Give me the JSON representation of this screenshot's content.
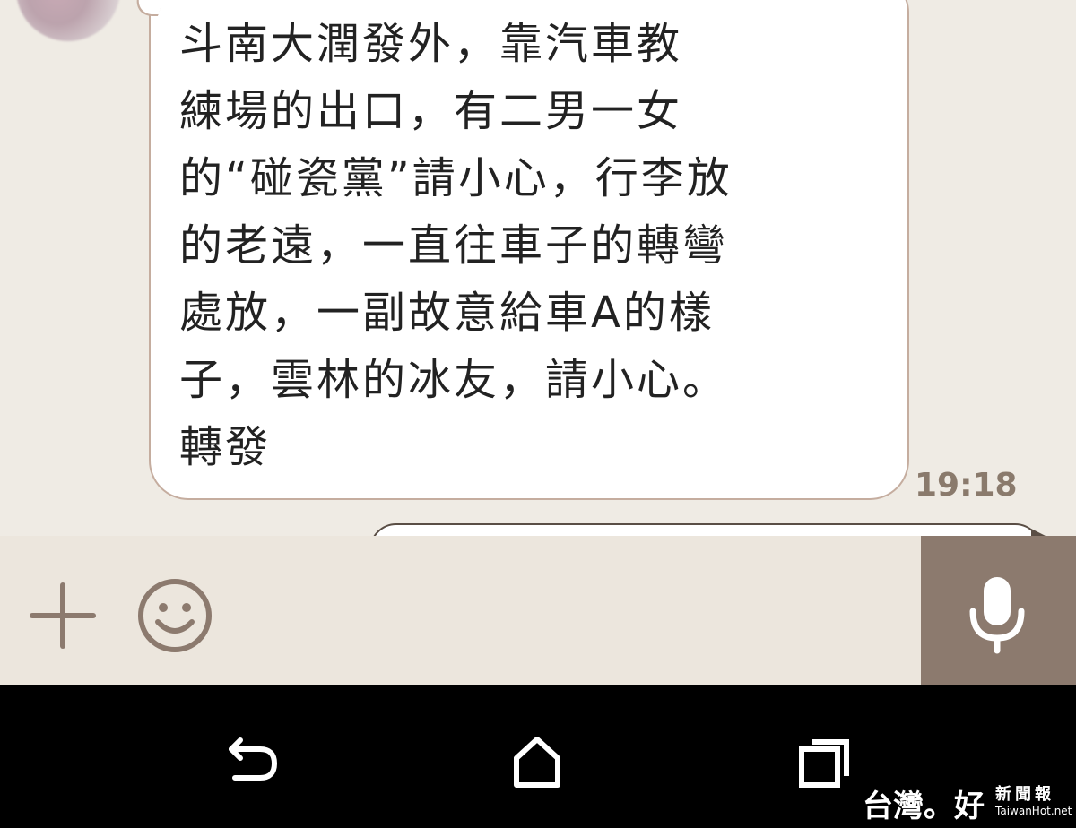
{
  "conversation": {
    "incoming_message": {
      "lines": [
        "斗南大潤發外，靠汽車教",
        "練場的出口，有二男一女",
        "的“碰瓷黨”請小心，行李放",
        "的老遠，一直往車子的轉彎",
        "處放，一副故意給車A的樣",
        "子，雲林的冰友，請小心。",
        "轉發"
      ],
      "time": "19:18"
    }
  },
  "input_bar": {
    "add_icon": "plus-icon",
    "emoji_icon": "smiley-icon",
    "voice_icon": "microphone-icon"
  },
  "navigation_bar": {
    "back_icon": "back-arrow-icon",
    "home_icon": "home-icon",
    "recents_icon": "recent-apps-icon"
  },
  "watermark": {
    "brand": "台灣。好",
    "subtitle": "新聞報",
    "site": "TaiwanHot.net"
  },
  "colors": {
    "chat_background": "#efebe4",
    "bubble_border": "#c5ad9f",
    "time_text": "#8a7a6c",
    "mic_button": "#8c7a6e",
    "icon_color": "#8c7a6e",
    "nav_background": "#000000"
  }
}
